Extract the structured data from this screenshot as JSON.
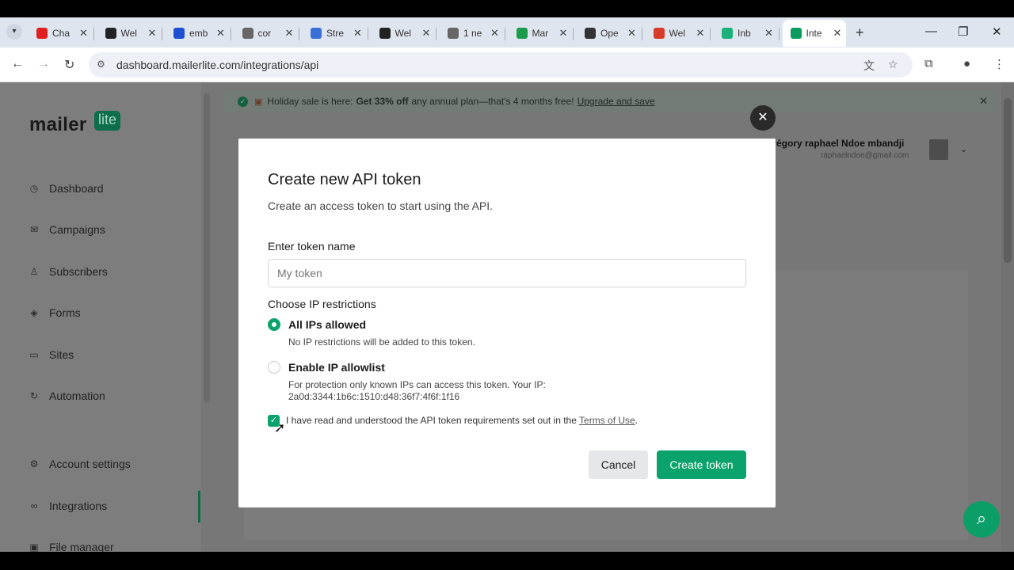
{
  "browser": {
    "tabs": [
      {
        "label": "Cha",
        "fav_color": "#e02020"
      },
      {
        "label": "Wel",
        "fav_color": "#222222"
      },
      {
        "label": "emb",
        "fav_color": "#1f4fd1"
      },
      {
        "label": "cor",
        "fav_color": "#666666"
      },
      {
        "label": "Stre",
        "fav_color": "#3a6fd8"
      },
      {
        "label": "Wel",
        "fav_color": "#222222"
      },
      {
        "label": "1 ne",
        "fav_color": "#666666"
      },
      {
        "label": "Mar",
        "fav_color": "#1a9a4a"
      },
      {
        "label": "Ope",
        "fav_color": "#333333"
      },
      {
        "label": "Wel",
        "fav_color": "#d83b2a"
      },
      {
        "label": "Inb",
        "fav_color": "#1cb07a"
      },
      {
        "label": "Inte",
        "fav_color": "#0a9c5e"
      }
    ],
    "url": "dashboard.mailerlite.com/integrations/api"
  },
  "sidebar": {
    "logo_text": "mailer",
    "logo_badge": "lite",
    "items": [
      {
        "label": "Dashboard",
        "icon": "clock-icon"
      },
      {
        "label": "Campaigns",
        "icon": "mail-icon"
      },
      {
        "label": "Subscribers",
        "icon": "user-icon"
      },
      {
        "label": "Forms",
        "icon": "layers-icon"
      },
      {
        "label": "Sites",
        "icon": "browser-icon"
      },
      {
        "label": "Automation",
        "icon": "refresh-icon"
      },
      {
        "label": "Account settings",
        "icon": "gear-icon"
      },
      {
        "label": "Integrations",
        "icon": "link-icon"
      },
      {
        "label": "File manager",
        "icon": "image-icon"
      }
    ]
  },
  "banner": {
    "text_pre": "Holiday sale is here:",
    "text_bold": "Get 33% off",
    "text_post": "any annual plan—that's 4 months free!",
    "link": "Upgrade and save"
  },
  "user": {
    "name": "grégory raphael Ndoe mbandji",
    "email": "raphaelndoe@gmail.com"
  },
  "modal": {
    "title": "Create new API token",
    "subtitle": "Create an access token to start using the API.",
    "token_label": "Enter token name",
    "token_placeholder": "My token",
    "ip_label": "Choose IP restrictions",
    "option_all_title": "All IPs allowed",
    "option_all_desc": "No IP restrictions will be added to this token.",
    "option_allowlist_title": "Enable IP allowlist",
    "option_allowlist_desc": "For protection only known IPs can access this token. Your IP:",
    "user_ip": "2a0d:3344:1b6c:1510:d48:36f7:4f6f:1f16",
    "agree_text": "I have read and understood the API token requirements set out in the",
    "agree_link": "Terms of Use",
    "agree_end": ".",
    "cancel_label": "Cancel",
    "create_label": "Create token"
  },
  "colors": {
    "accent": "#09a36b",
    "overlay": "#7a7a7a"
  }
}
